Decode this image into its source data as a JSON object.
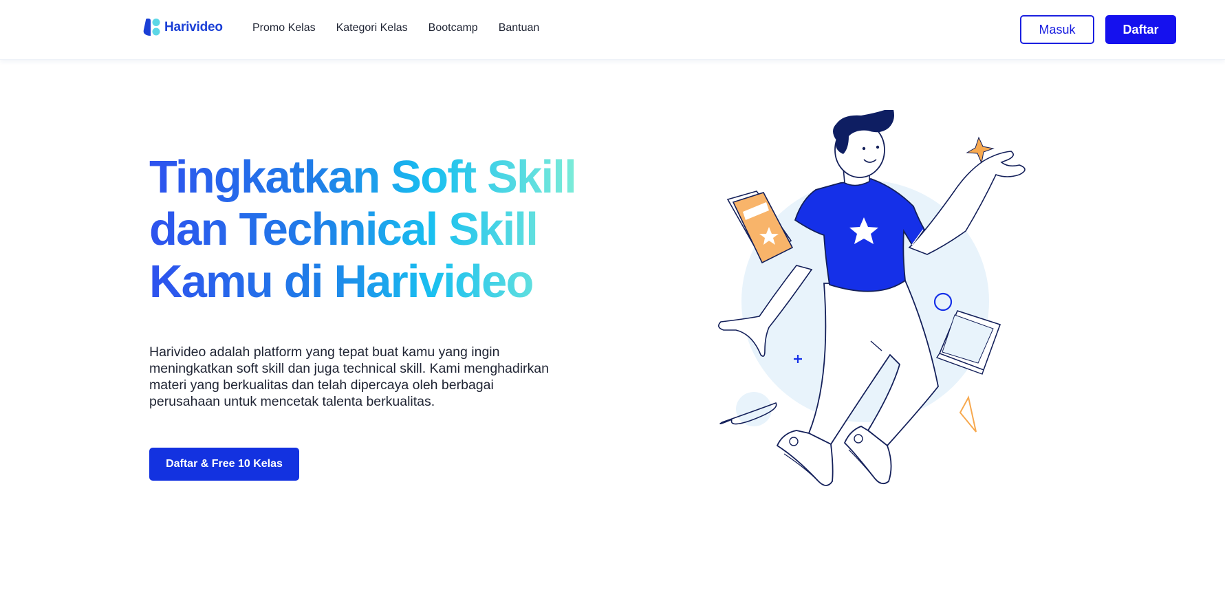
{
  "brand": {
    "name": "Harivideo",
    "icon": "harivideo-logo-icon",
    "accent": "#1511ee",
    "logo_colors": [
      "#1a3fd6",
      "#5cd7e6"
    ]
  },
  "nav": {
    "links": [
      {
        "label": "Promo Kelas"
      },
      {
        "label": "Kategori Kelas"
      },
      {
        "label": "Bootcamp"
      },
      {
        "label": "Bantuan"
      }
    ],
    "login_label": "Masuk",
    "register_label": "Daftar"
  },
  "hero": {
    "title": "Tingkatkan Soft Skill dan Technical Skill Kamu di Harivideo",
    "title_gradient": [
      "#2e52ee",
      "#1f7ee8",
      "#19bff0",
      "#86f0d6"
    ],
    "description": "Harivideo adalah platform yang tepat buat kamu yang ingin meningkatkan soft skill dan juga technical skill. Kami menghadirkan materi yang berkualitas dan telah dipercaya oleh berbagai perusahaan untuk mencetak talenta berkualitas.",
    "cta_label": "Daftar & Free 10 Kelas"
  },
  "illustration": {
    "name": "person-floating-with-books-illustration",
    "colors": {
      "shirt": "#1530e8",
      "outline": "#14205a",
      "book": "#f8b46a",
      "sparkle": "#f7a94f",
      "backdrop": "#e8f3fb"
    }
  }
}
